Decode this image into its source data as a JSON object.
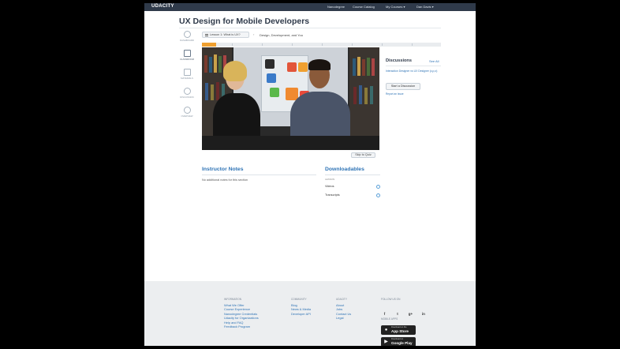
{
  "topbar": {
    "logo": "UDACITY",
    "nav": [
      "Nanodegree",
      "Course Catalog",
      "My Courses ▾",
      "Dan Davis ▾"
    ]
  },
  "course": {
    "title": "UX Design for Mobile Developers"
  },
  "breadcrumb": {
    "lesson": "Lesson 1: What is UX?",
    "separator": "›",
    "current": "Design, Development, and You"
  },
  "sidebar": {
    "items": [
      {
        "label": "Dashboard",
        "icon": "dashboard-icon"
      },
      {
        "label": "Classroom",
        "icon": "play-icon"
      },
      {
        "label": "Materials",
        "icon": "materials-icon"
      },
      {
        "label": "Discussion",
        "icon": "discussion-icon"
      },
      {
        "label": "Overview",
        "icon": "overview-icon"
      }
    ]
  },
  "video": {
    "skip_label": "Skip to Quiz"
  },
  "instructor_notes": {
    "title": "Instructor Notes",
    "text": "No additional notes for this section"
  },
  "downloadables": {
    "title": "Downloadables",
    "lesson_label": "Lesson",
    "items": [
      "Videos",
      "Transcripts"
    ]
  },
  "discussions": {
    "title": "Discussions",
    "see_all": "See All",
    "item": "Interaction Designer vs UX Designer (c,p,o)",
    "start_button": "Start a Discussion",
    "report": "Report an Issue"
  },
  "footer": {
    "columns": [
      {
        "heading": "Information",
        "links": [
          "What We Offer",
          "Course Experience",
          "Nanodegree Credentials",
          "Udacity for Organizations",
          "Help and FAQ",
          "Feedback Program"
        ]
      },
      {
        "heading": "Community",
        "links": [
          "Blog",
          "News & Media",
          "Developer API"
        ]
      },
      {
        "heading": "Udacity",
        "links": [
          "About",
          "Jobs",
          "Contact Us",
          "Legal"
        ]
      }
    ],
    "follow_heading": "Follow Us On",
    "social": [
      "f",
      "t",
      "g+",
      "in"
    ],
    "apps_heading": "Mobile Apps",
    "app_store": {
      "small": "Download on the",
      "big": "App Store"
    },
    "google_play": {
      "small": "Download on",
      "big": "Google Play"
    }
  },
  "colors": {
    "accent": "#2e73b5",
    "topbar": "#2f3a4a",
    "progress": "#f0a030"
  }
}
